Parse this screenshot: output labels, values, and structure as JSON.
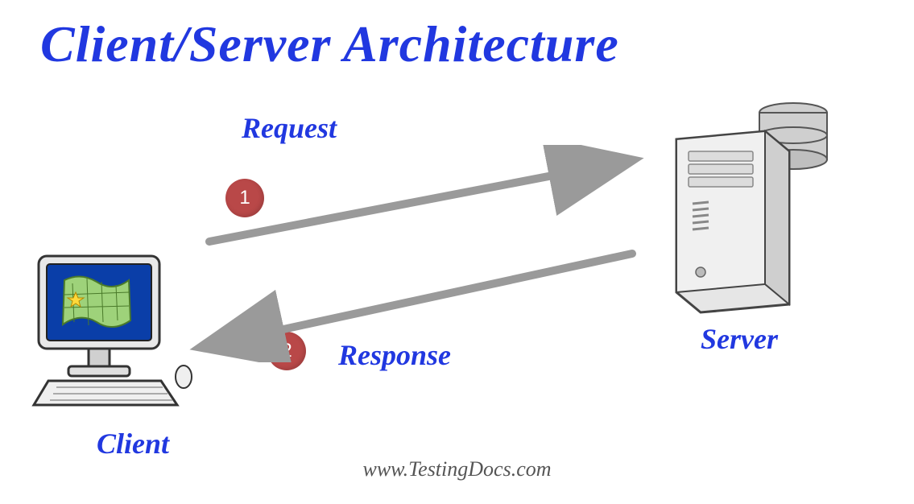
{
  "title": "Client/Server Architecture",
  "labels": {
    "request": "Request",
    "response": "Response",
    "server": "Server",
    "client": "Client"
  },
  "badges": {
    "request_step": "1",
    "response_step": "2"
  },
  "footer": "www.TestingDocs.com",
  "icons": {
    "client": "client-computer-icon",
    "server": "server-tower-icon"
  },
  "colors": {
    "heading": "#2138e0",
    "badge": "#b94848",
    "arrow": "#9a9a9a"
  }
}
